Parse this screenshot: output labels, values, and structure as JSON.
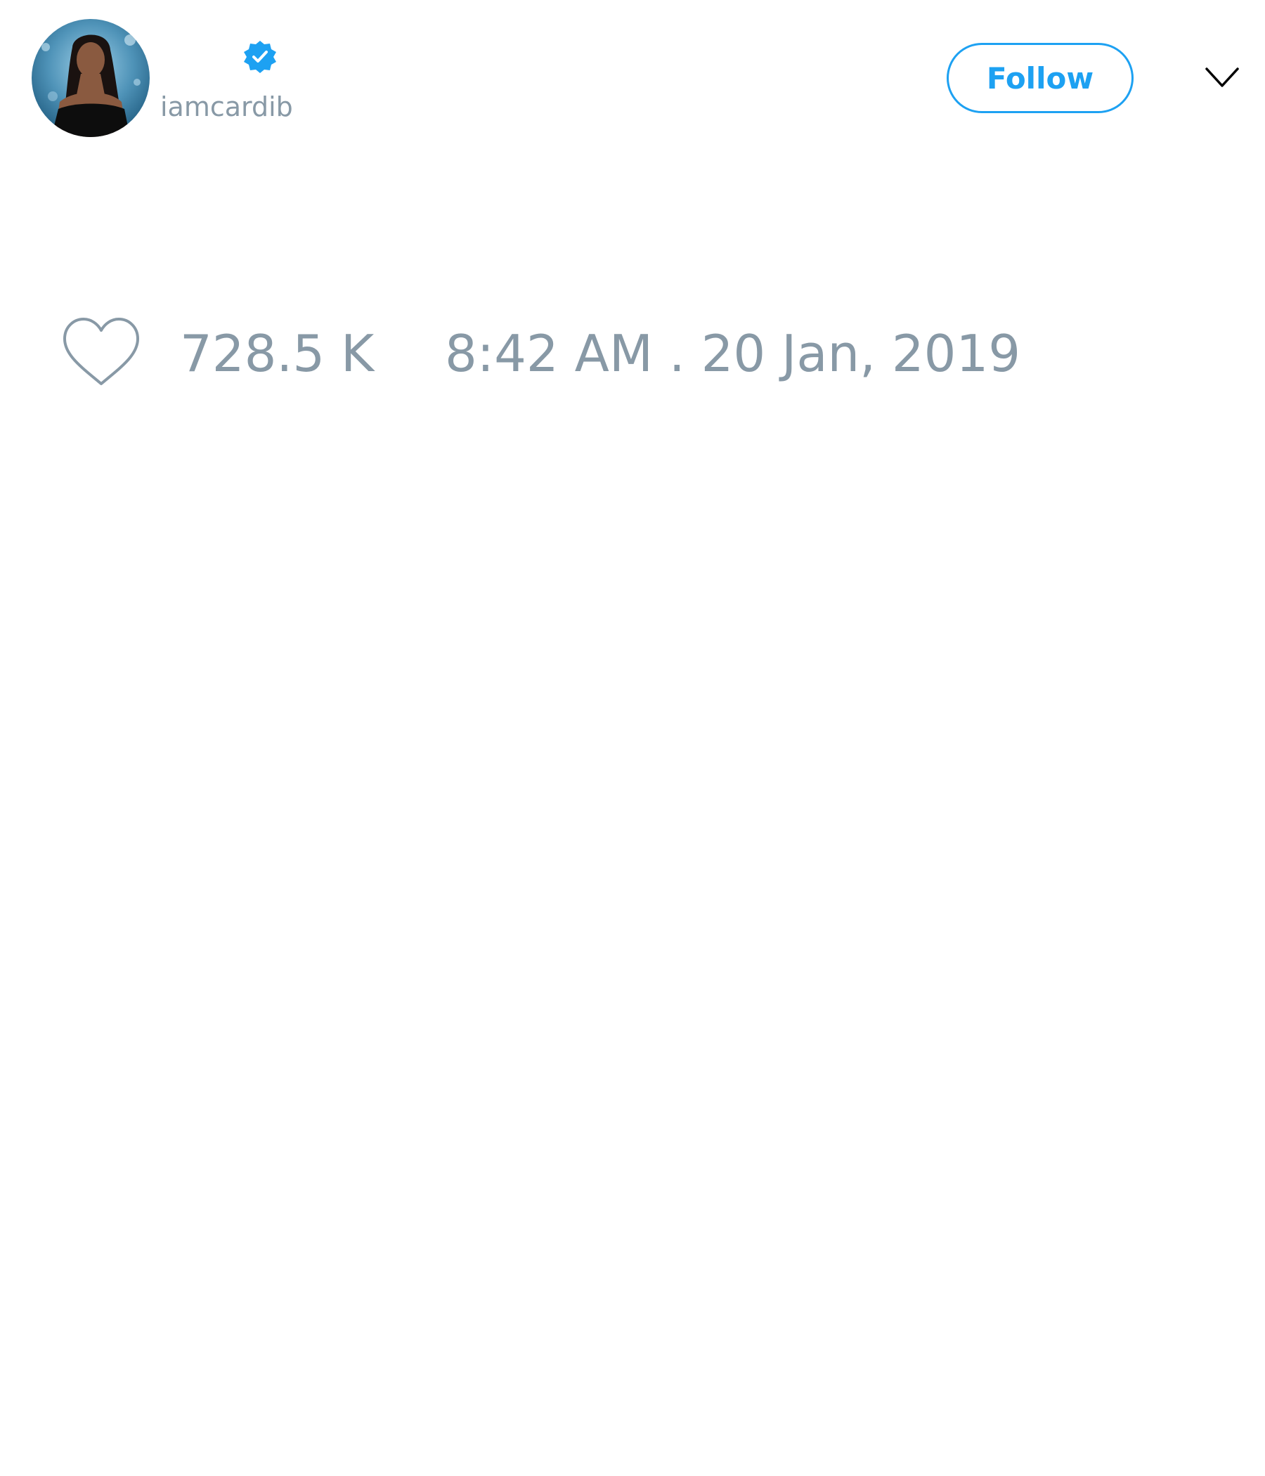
{
  "user": {
    "handle": "iamcardib",
    "avatar_icon": "profile-photo",
    "verified_icon": "verified-badge-icon"
  },
  "header": {
    "follow_label": "Follow",
    "menu_icon": "chevron-down-icon"
  },
  "tweet": {
    "like_icon": "heart-icon",
    "like_count": "728.5 K",
    "timestamp": "8:42 AM . 20 Jan, 2019"
  },
  "colors": {
    "accent": "#1da1f2",
    "muted_text": "#8899a6",
    "background": "#ffffff"
  }
}
